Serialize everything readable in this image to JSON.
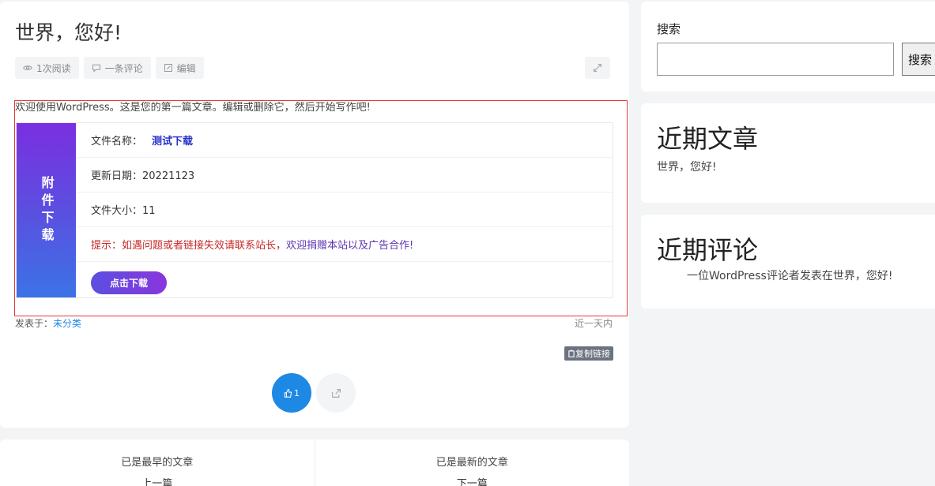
{
  "post": {
    "title": "世界，您好!",
    "meta": {
      "reads": "1次阅读",
      "comments": "一条评论",
      "edit": "编辑"
    },
    "intro": "欢迎使用WordPress。这是您的第一篇文章。编辑或删除它，然后开始写作吧!",
    "download": {
      "side_label": "附件下载",
      "file_name_label": "文件名称：",
      "file_name": "测试下载",
      "update_date": "更新日期：20221123",
      "file_size": "文件大小：11",
      "tip_red": "提示：如遇问题或者链接失效请联系站长，",
      "tip_purple": "欢迎捐赠本站以及广告合作!",
      "button": "点击下载"
    },
    "posted_in_label": "发表于：",
    "category": "未分类",
    "posted_when": "近一天内",
    "copy_link": "复制链接",
    "likes": "1"
  },
  "nav": {
    "prev_note": "已是最早的文章",
    "prev_label": "上一篇",
    "next_note": "已是最新的文章",
    "next_label": "下一篇"
  },
  "sidebar": {
    "search_label": "搜索",
    "search_value": "",
    "search_button": "搜索",
    "recent_posts_title": "近期文章",
    "recent_post_1": "世界，您好!",
    "recent_comments_title": "近期评论",
    "recent_comment_1": "一位WordPress评论者发表在世界，您好!"
  },
  "colors": {
    "accent_blue": "#1e88e5",
    "frame_red": "#e53935",
    "gradient_start": "#7b2fe0",
    "gradient_end": "#3b73e6"
  }
}
